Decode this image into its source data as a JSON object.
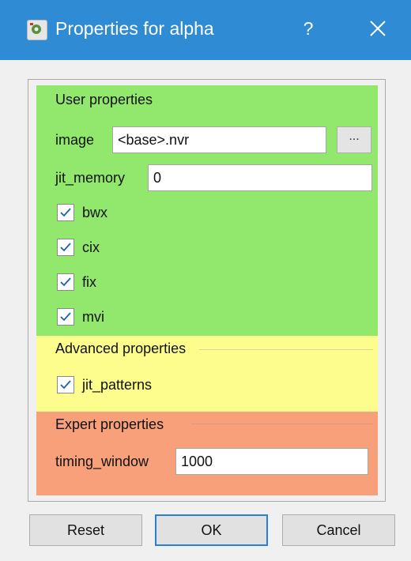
{
  "window": {
    "title": "Properties for alpha",
    "help_label": "?",
    "title_bar_color": "#2e8bd4"
  },
  "groups": {
    "user": {
      "title": "User properties",
      "color": "#92e86d",
      "image": {
        "label": "image",
        "value": "<base>.nvr",
        "browse_label": "..."
      },
      "jit_memory": {
        "label": "jit_memory",
        "value": "0"
      },
      "checkboxes": [
        {
          "label": "bwx",
          "checked": true
        },
        {
          "label": "cix",
          "checked": true
        },
        {
          "label": "fix",
          "checked": true
        },
        {
          "label": "mvi",
          "checked": true
        }
      ]
    },
    "advanced": {
      "title": "Advanced properties",
      "color": "#fdfd8e",
      "checkboxes": [
        {
          "label": "jit_patterns",
          "checked": true
        }
      ]
    },
    "expert": {
      "title": "Expert properties",
      "color": "#f8a07a",
      "timing_window": {
        "label": "timing_window",
        "value": "1000"
      }
    }
  },
  "buttons": {
    "reset": "Reset",
    "ok": "OK",
    "cancel": "Cancel"
  },
  "icons": {
    "app": "app-icon",
    "close": "close-icon",
    "check": "checkmark-icon"
  }
}
